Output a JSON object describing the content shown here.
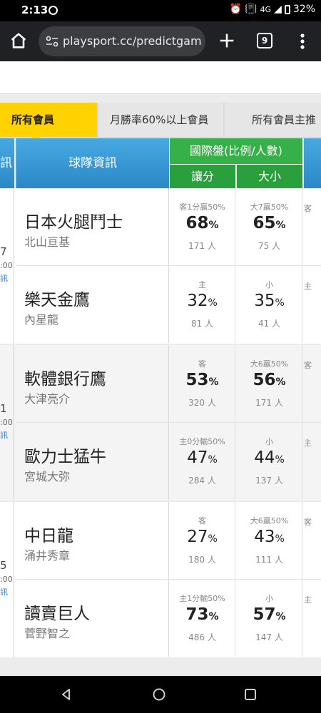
{
  "status_bar": {
    "time": "2:13",
    "network": "4G",
    "battery": "32%"
  },
  "browser": {
    "url": "playsport.cc/predictgam",
    "tab_count": "9"
  },
  "tabs": [
    {
      "label": "所有會員"
    },
    {
      "label": "月勝率60%以上會員"
    },
    {
      "label": "所有會員主推"
    }
  ],
  "table_header": {
    "left_partial": "訊",
    "team_info": "球隊資訊",
    "intl_line": "國際盤(比例/人數)",
    "spread": "讓分",
    "over_under": "大小"
  },
  "games": [
    {
      "left": {
        "num": "7",
        "time": ":00",
        "link": "訊"
      },
      "teams": [
        {
          "name": "日本火腿鬥士",
          "pitcher": "北山亘基",
          "spread": {
            "label": "客1分贏50%",
            "pct": "68",
            "count": "171 人",
            "strong": true
          },
          "ou": {
            "label": "大7贏50%",
            "pct": "65",
            "count": "75 人",
            "strong": true
          },
          "cut": "客"
        },
        {
          "name": "樂天金鷹",
          "pitcher": "內星龍",
          "spread": {
            "label": "主",
            "pct": "32",
            "count": "81 人",
            "strong": false
          },
          "ou": {
            "label": "小",
            "pct": "35",
            "count": "41 人",
            "strong": false
          },
          "cut": "主"
        }
      ]
    },
    {
      "left": {
        "num": "1",
        "time": ":00",
        "link": "訊"
      },
      "teams": [
        {
          "name": "軟體銀行鷹",
          "pitcher": "大津亮介",
          "spread": {
            "label": "客",
            "pct": "53",
            "count": "320 人",
            "strong": true
          },
          "ou": {
            "label": "大6贏50%",
            "pct": "56",
            "count": "171 人",
            "strong": true
          },
          "cut": "客"
        },
        {
          "name": "歐力士猛牛",
          "pitcher": "宮城大弥",
          "spread": {
            "label": "主0分輸50%",
            "pct": "47",
            "count": "284 人",
            "strong": false
          },
          "ou": {
            "label": "小",
            "pct": "44",
            "count": "137 人",
            "strong": false
          },
          "cut": "主"
        }
      ]
    },
    {
      "left": {
        "num": "5",
        "time": ":00",
        "link": "訊"
      },
      "teams": [
        {
          "name": "中日龍",
          "pitcher": "涌井秀章",
          "spread": {
            "label": "客",
            "pct": "27",
            "count": "180 人",
            "strong": false
          },
          "ou": {
            "label": "大6贏50%",
            "pct": "43",
            "count": "111 人",
            "strong": false
          },
          "cut": "客"
        },
        {
          "name": "讀賣巨人",
          "pitcher": "菅野智之",
          "spread": {
            "label": "主1分輸50%",
            "pct": "73",
            "count": "486 人",
            "strong": true
          },
          "ou": {
            "label": "小",
            "pct": "57",
            "count": "147 人",
            "strong": true
          },
          "cut": "主"
        }
      ]
    }
  ],
  "percent_symbol": "%",
  "colors": {
    "tab_active": "#ffd200",
    "header_blue": "#2b88c8",
    "header_green": "#36b049"
  }
}
